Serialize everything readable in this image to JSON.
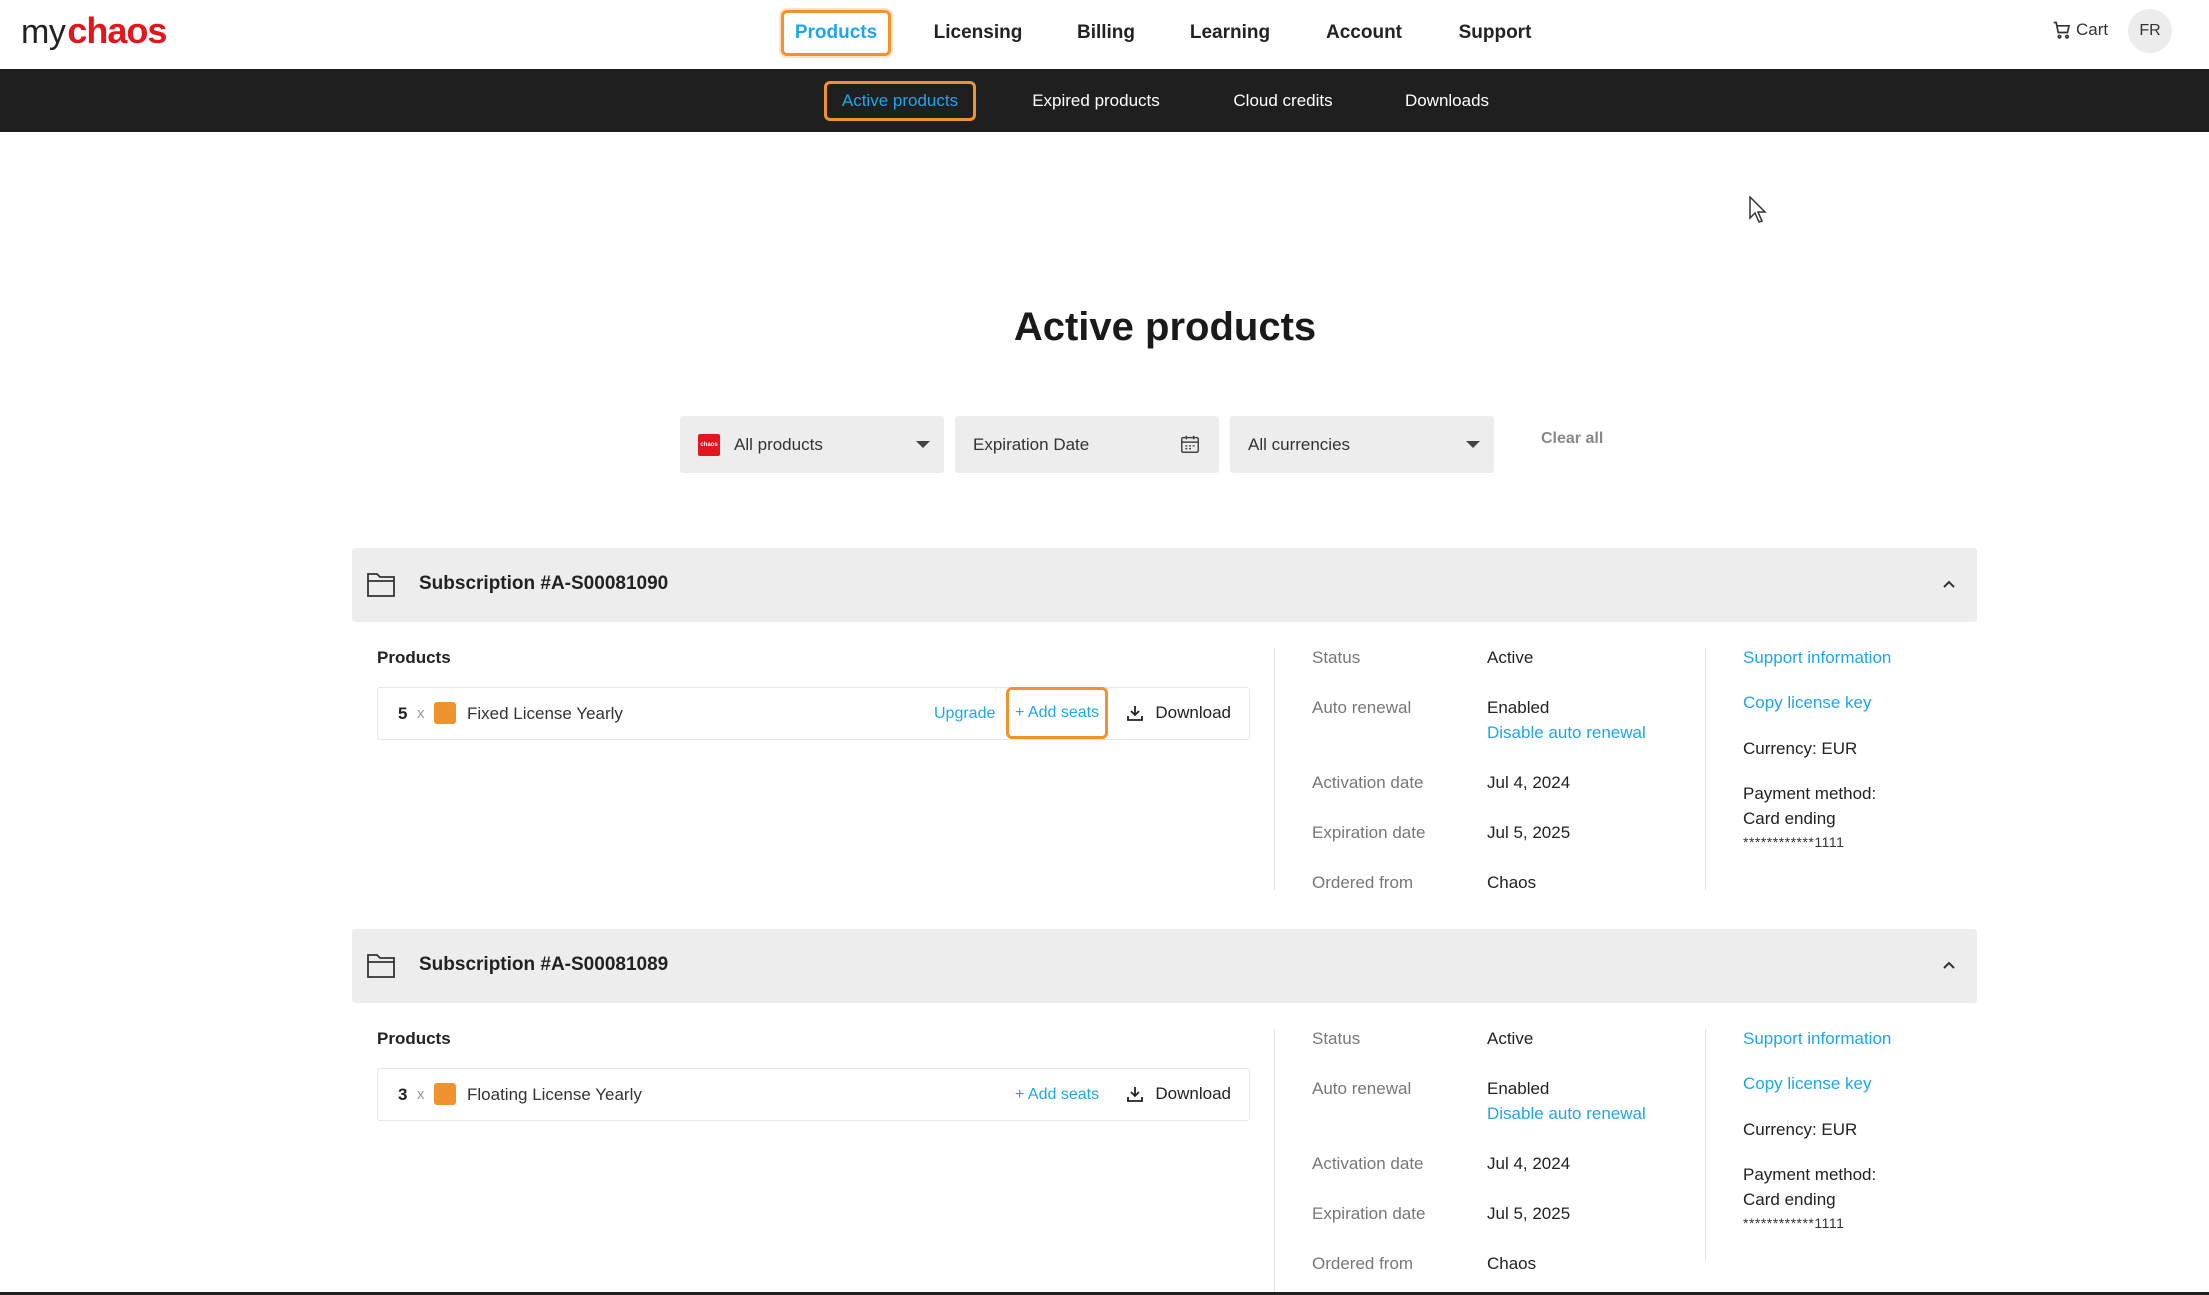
{
  "brand": {
    "my": "my",
    "chaos": "chaos"
  },
  "nav": {
    "items": [
      {
        "label": "Products",
        "active": true
      },
      {
        "label": "Licensing"
      },
      {
        "label": "Billing"
      },
      {
        "label": "Learning"
      },
      {
        "label": "Account"
      },
      {
        "label": "Support"
      }
    ],
    "cart": "Cart",
    "user_initials": "FR"
  },
  "subnav": {
    "items": [
      {
        "label": "Active products",
        "active": true
      },
      {
        "label": "Expired products"
      },
      {
        "label": "Cloud credits"
      },
      {
        "label": "Downloads"
      }
    ]
  },
  "page": {
    "title": "Active products"
  },
  "filters": {
    "products": "All products",
    "expiration": "Expiration Date",
    "currencies": "All currencies",
    "clear_all": "Clear all",
    "chaos_mini": "chaos"
  },
  "subscriptions": [
    {
      "title": "Subscription #A-S00081090",
      "products_label": "Products",
      "product": {
        "qty": "5",
        "x": "x",
        "name": "Fixed License Yearly",
        "upgrade": "Upgrade",
        "add_seats": "+ Add seats",
        "download": "Download"
      },
      "status_label": "Status",
      "status": "Active",
      "auto_label": "Auto renewal",
      "auto": "Enabled",
      "disable_link": "Disable auto renewal",
      "activation_label": "Activation date",
      "activation": "Jul 4, 2024",
      "expiration_label": "Expiration date",
      "expiration": "Jul 5, 2025",
      "ordered_label": "Ordered from",
      "ordered": "Chaos",
      "support_link": "Support information",
      "copy_link": "Copy license key",
      "currency": "Currency: EUR",
      "payment_method": "Payment method:",
      "card_ending": "Card ending",
      "card_mask": "************1111"
    },
    {
      "title": "Subscription #A-S00081089",
      "products_label": "Products",
      "product": {
        "qty": "3",
        "x": "x",
        "name": "Floating License Yearly",
        "add_seats": "+ Add seats",
        "download": "Download"
      },
      "status_label": "Status",
      "status": "Active",
      "auto_label": "Auto renewal",
      "auto": "Enabled",
      "disable_link": "Disable auto renewal",
      "activation_label": "Activation date",
      "activation": "Jul 4, 2024",
      "expiration_label": "Expiration date",
      "expiration": "Jul 5, 2025",
      "ordered_label": "Ordered from",
      "ordered": "Chaos",
      "support_link": "Support information",
      "copy_link": "Copy license key",
      "currency": "Currency: EUR",
      "payment_method": "Payment method:",
      "card_ending": "Card ending",
      "card_mask": "************1111"
    }
  ],
  "colors": {
    "accent": "#1ea7e8",
    "brand": "#e1161e",
    "highlight": "#f0922e"
  }
}
